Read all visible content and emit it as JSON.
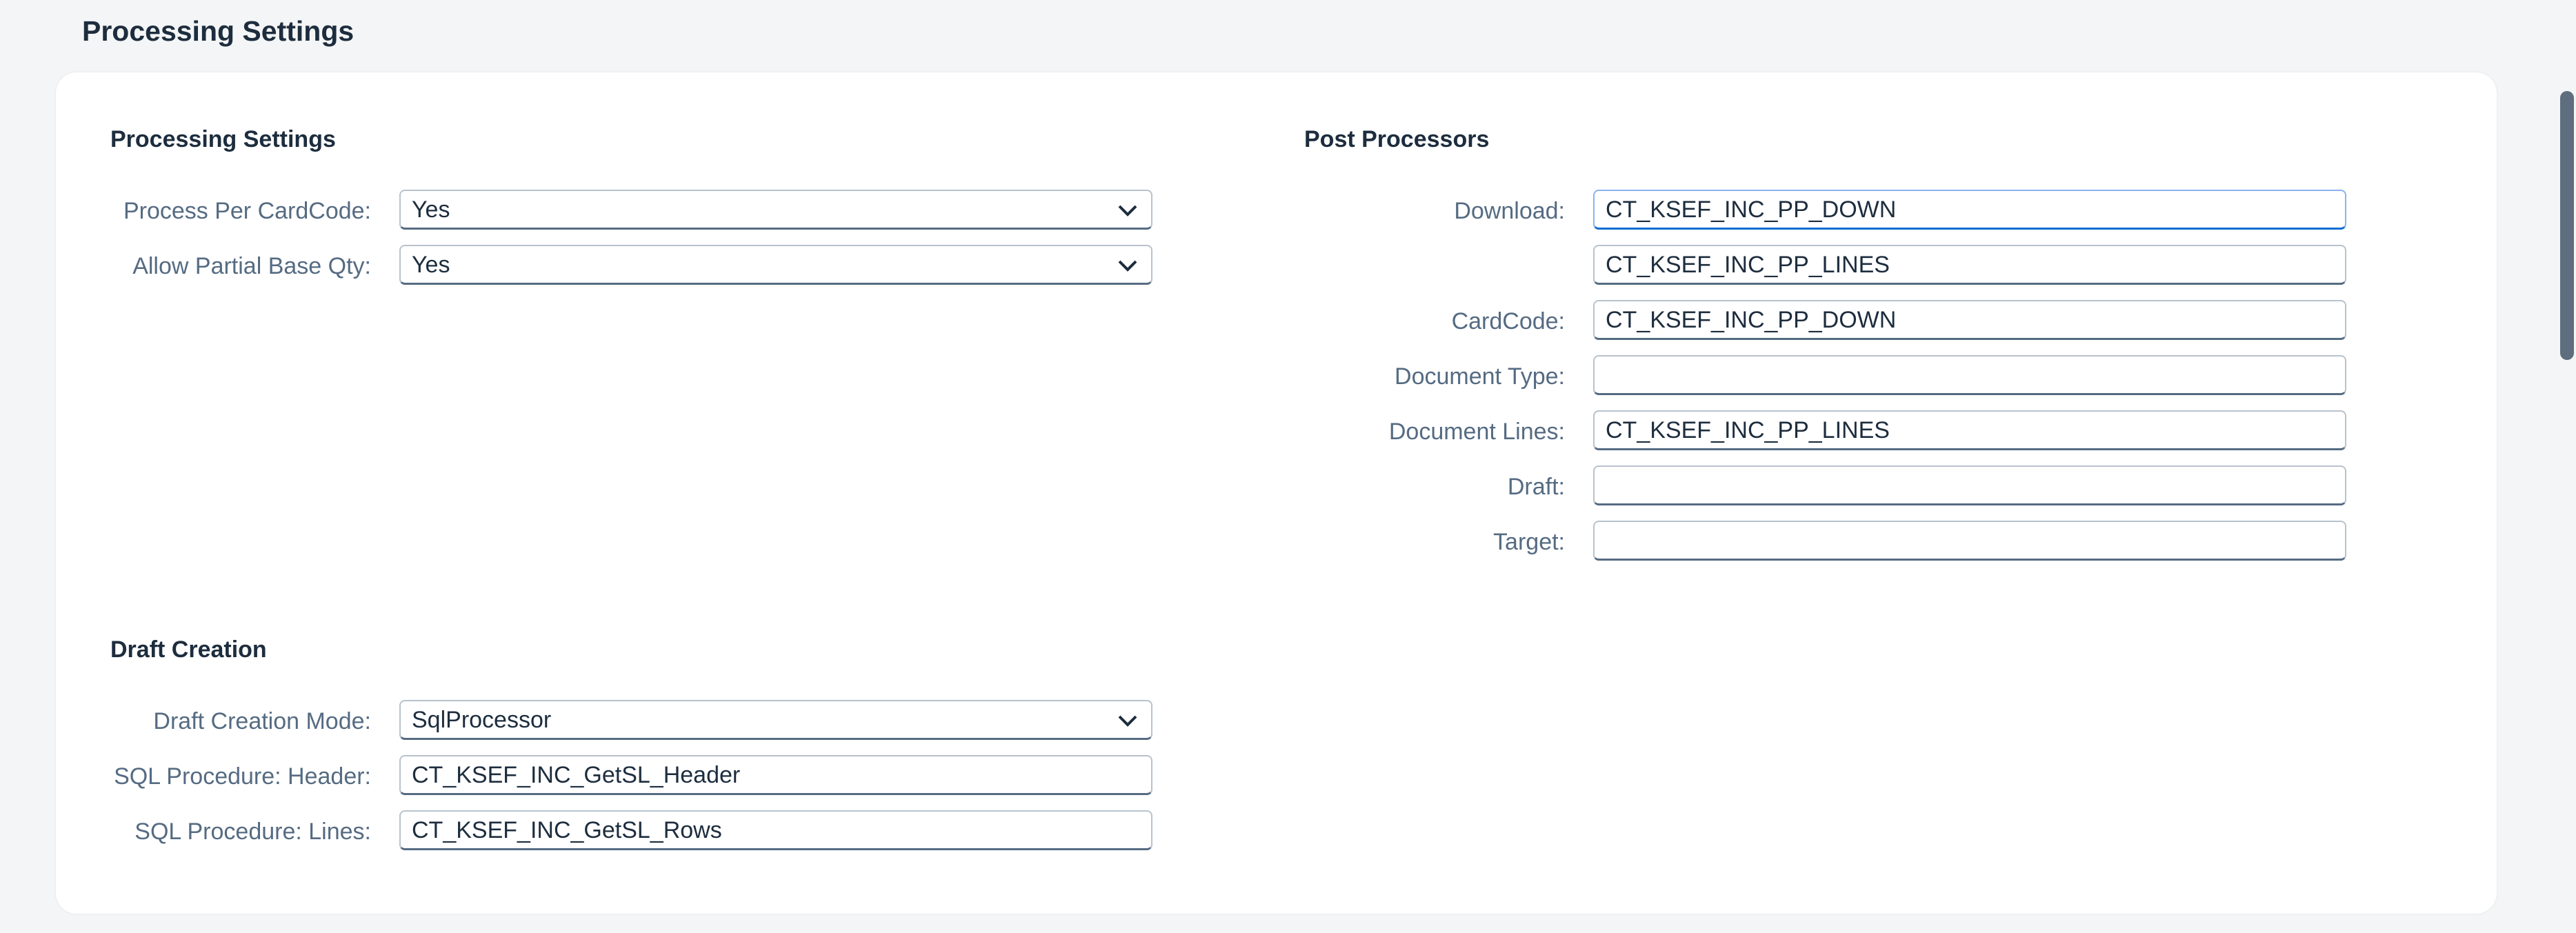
{
  "page": {
    "title": "Processing Settings"
  },
  "processing_settings": {
    "title": "Processing Settings",
    "process_per_cardcode": {
      "label": "Process Per CardCode:",
      "value": "Yes"
    },
    "allow_partial_base_qty": {
      "label": "Allow Partial Base Qty:",
      "value": "Yes"
    }
  },
  "draft_creation": {
    "title": "Draft Creation",
    "mode": {
      "label": "Draft Creation Mode:",
      "value": "SqlProcessor"
    },
    "sql_header": {
      "label": "SQL Procedure: Header:",
      "value": "CT_KSEF_INC_GetSL_Header"
    },
    "sql_lines": {
      "label": "SQL Procedure: Lines:",
      "value": "CT_KSEF_INC_GetSL_Rows"
    }
  },
  "post_processors": {
    "title": "Post Processors",
    "download": {
      "label": "Download:",
      "value": "CT_KSEF_INC_PP_DOWN",
      "value2": "CT_KSEF_INC_PP_LINES"
    },
    "cardcode": {
      "label": "CardCode:",
      "value": "CT_KSEF_INC_PP_DOWN"
    },
    "document_type": {
      "label": "Document Type:",
      "value": ""
    },
    "document_lines": {
      "label": "Document Lines:",
      "value": "CT_KSEF_INC_PP_LINES"
    },
    "draft": {
      "label": "Draft:",
      "value": ""
    },
    "target": {
      "label": "Target:",
      "value": ""
    }
  },
  "icons": {
    "dropdown": "chevron-down-icon"
  },
  "colors": {
    "page_background": "#f4f5f6",
    "card_background": "#ffffff",
    "label_text": "#556b82",
    "heading_text": "#1d2d3e",
    "focus_border": "#0a6ed1"
  }
}
